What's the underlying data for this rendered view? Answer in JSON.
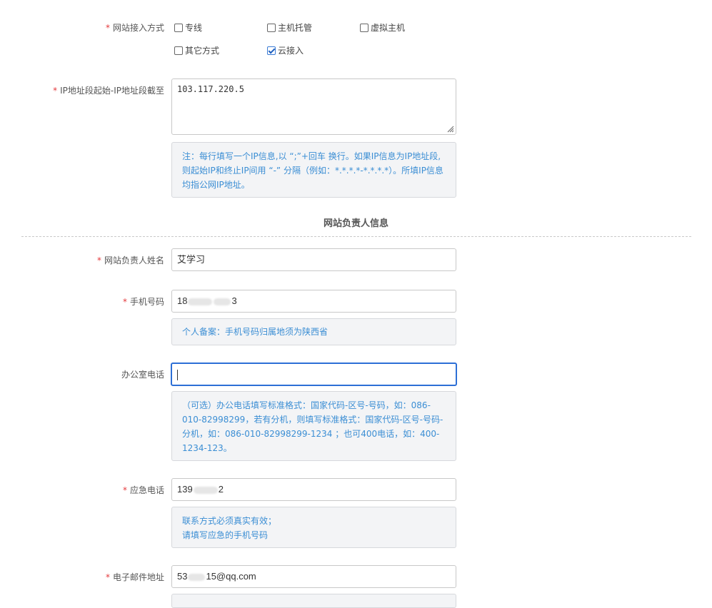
{
  "access": {
    "label": "网站接入方式",
    "options": [
      {
        "label": "专线",
        "checked": false
      },
      {
        "label": "主机托管",
        "checked": false
      },
      {
        "label": "虚拟主机",
        "checked": false
      },
      {
        "label": "其它方式",
        "checked": false
      },
      {
        "label": "云接入",
        "checked": true
      }
    ]
  },
  "ip": {
    "label": "IP地址段起始-IP地址段截至",
    "value": "103.117.220.5",
    "note": "注：每行填写一个IP信息,以 “;”+回车 换行。如果IP信息为IP地址段,则起始IP和终止IP间用 “-” 分隔（例如：*.*.*.*-*.*.*.*）。所填IP信息均指公网IP地址。"
  },
  "section": {
    "title": "网站负责人信息"
  },
  "name": {
    "label": "网站负责人姓名",
    "value": "艾学习"
  },
  "mobile": {
    "label": "手机号码",
    "value_start": "18",
    "value_end": "3",
    "note": "个人备案：手机号码归属地须为陕西省"
  },
  "office": {
    "label": "办公室电话",
    "value": "",
    "note": "（可选）办公电话填写标准格式：国家代码-区号-号码，如：086-010-82998299，若有分机，则填写标准格式：国家代码-区号-号码-分机，如：086-010-82998299-1234 ；也可400电话，如：400-1234-123。"
  },
  "emergency": {
    "label": "应急电话",
    "value_start": "139",
    "value_end": "2",
    "note_line1": "联系方式必须真实有效；",
    "note_line2": "请填写应急的手机号码"
  },
  "email": {
    "label": "电子邮件地址",
    "value_start": "53",
    "value_end": "15@qq.com"
  },
  "colors": {
    "required": "#e4393c",
    "note_text": "#3b8ed4",
    "note_bg": "#f3f4f6",
    "focus_border": "#2d6fd6"
  }
}
